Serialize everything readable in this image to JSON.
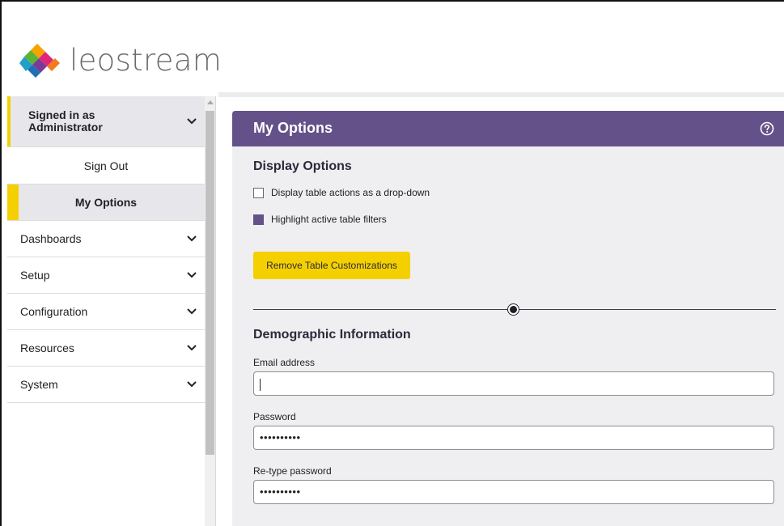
{
  "brand": {
    "name": "leostream"
  },
  "sidebar": {
    "signed_in": "Signed in as Administrator",
    "sign_out": "Sign Out",
    "my_options": "My Options",
    "menu": [
      {
        "label": "Dashboards"
      },
      {
        "label": "Setup"
      },
      {
        "label": "Configuration"
      },
      {
        "label": "Resources"
      },
      {
        "label": "System"
      }
    ]
  },
  "panel": {
    "title": "My Options",
    "help_icon": "help-circle-icon",
    "display_options": {
      "title": "Display Options",
      "checkboxes": [
        {
          "label": "Display table actions as a drop-down",
          "checked": false
        },
        {
          "label": "Highlight active table filters",
          "checked": true
        }
      ],
      "button": "Remove Table Customizations"
    },
    "demographic": {
      "title": "Demographic Information",
      "email": {
        "label": "Email address",
        "value": ""
      },
      "password": {
        "label": "Password",
        "value": "••••••••••"
      },
      "retype": {
        "label": "Re-type password",
        "value": "••••••••••"
      }
    }
  },
  "colors": {
    "accent_purple": "#64518a",
    "accent_yellow": "#f4d000",
    "sidebar_active_bg": "#e7e6eb",
    "panel_bg": "#efeef1"
  }
}
